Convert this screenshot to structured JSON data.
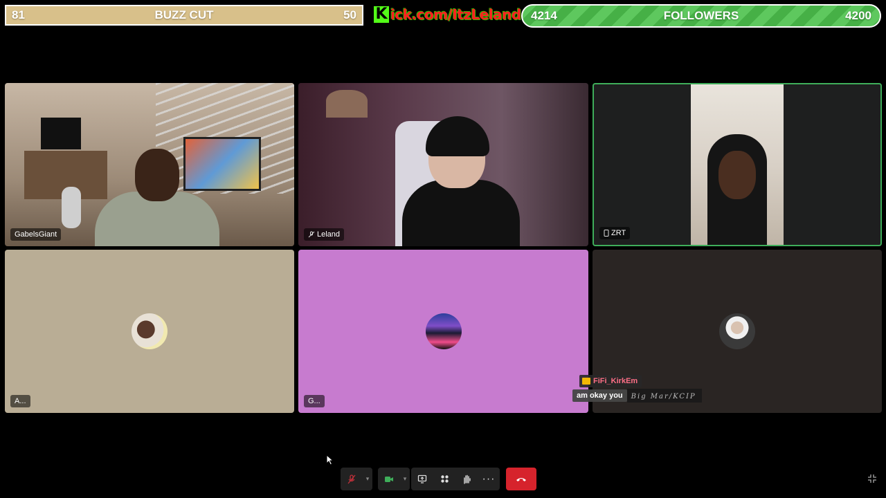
{
  "goal_bar": {
    "left_value": "81",
    "title": "BUZZ CUT",
    "right_value": "50"
  },
  "kick_banner": {
    "logo_letter": "K",
    "url": "ick.com/ItzLeland"
  },
  "followers_bar": {
    "current": "4214",
    "title": "FOLLOWERS",
    "goal": "4200"
  },
  "tiles": [
    {
      "name": "GabelsGiant"
    },
    {
      "name": "Leland",
      "icon": "mic-muted-icon"
    },
    {
      "name": "ZRT",
      "icon": "phone-icon"
    },
    {
      "name": "A..."
    },
    {
      "name": "G..."
    },
    {
      "name": ""
    }
  ],
  "chat": {
    "username": "FiFi_KirkEm",
    "message": "am okay you",
    "sub_text": "Big Mar/KCIP"
  },
  "controls": {
    "mic": "mic-muted-icon",
    "camera": "camera-icon",
    "share": "screen-share-icon",
    "layout": "grid-icon",
    "reactions": "raise-hand-icon",
    "more": "more-icon",
    "end": "end-call-icon"
  },
  "colors": {
    "active_speaker": "#3fae5a",
    "end_call": "#d6232c",
    "goal_bar": "#d8c08a",
    "followers_bar": "#5ec85e"
  }
}
